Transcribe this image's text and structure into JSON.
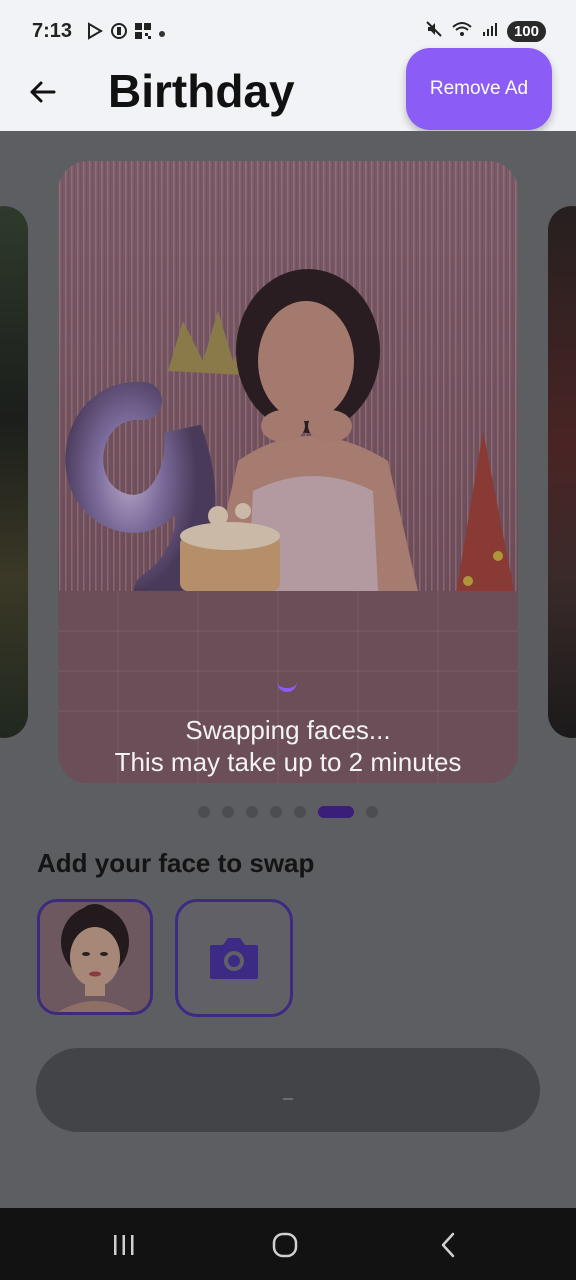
{
  "status_bar": {
    "time": "7:13",
    "battery": "100",
    "left_icons": [
      "play-store-icon",
      "nfc-icon",
      "qr-icon",
      "notification-dot-icon"
    ],
    "right_icons": [
      "mute-icon",
      "wifi-icon",
      "signal-icon",
      "battery-icon"
    ]
  },
  "header": {
    "title": "Birthday",
    "remove_ad_label": "Remove Ad",
    "back_icon": "arrow-left-icon"
  },
  "carousel": {
    "swap_status_line1": "Swapping faces...",
    "swap_status_line2": "This may take up to 2 minutes",
    "page_count": 7,
    "active_page": 5
  },
  "face_section": {
    "title": "Add your face to swap",
    "camera_icon": "camera-icon"
  },
  "colors": {
    "accent": "#8b5cf6",
    "accent_dark": "#3b1d7a",
    "overlay": "#5e5f63"
  },
  "nav_bar": {
    "icons": [
      "recents-icon",
      "home-icon",
      "back-icon"
    ]
  }
}
